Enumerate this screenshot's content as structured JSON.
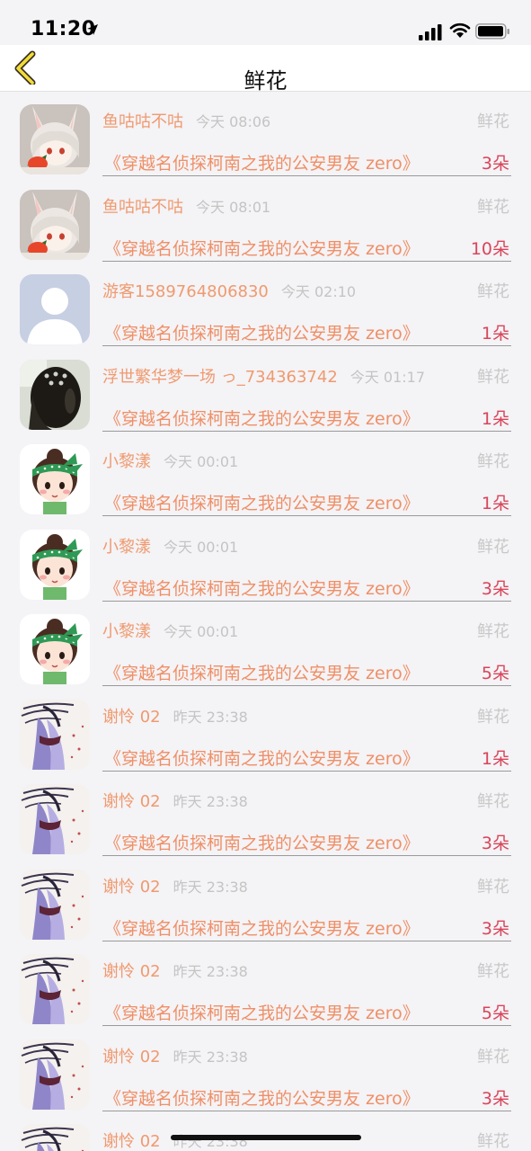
{
  "status": {
    "time": "11:20"
  },
  "nav": {
    "title": "鲜花"
  },
  "colors": {
    "name": "#ef9a6f",
    "book": "#ef8f66",
    "count": "#d8455a",
    "back": "#f2dc3a"
  },
  "items": [
    {
      "avatar": "bunny-girl",
      "name": "鱼咕咕不咕",
      "time": "今天 08:06",
      "kind": "鲜花",
      "book": "《穿越名侦探柯南之我的公安男友 zero》",
      "count": "3朵"
    },
    {
      "avatar": "bunny-girl",
      "name": "鱼咕咕不咕",
      "time": "今天 08:01",
      "kind": "鲜花",
      "book": "《穿越名侦探柯南之我的公安男友 zero》",
      "count": "10朵"
    },
    {
      "avatar": "default-user",
      "name": "游客1589764806830",
      "time": "今天 02:10",
      "kind": "鲜花",
      "book": "《穿越名侦探柯南之我的公安男友 zero》",
      "count": "1朵"
    },
    {
      "avatar": "dark-hair",
      "name": "浮世繁华梦一场 っ_734363742",
      "time": "今天 01:17",
      "kind": "鲜花",
      "book": "《穿越名侦探柯南之我的公安男友 zero》",
      "count": "1朵"
    },
    {
      "avatar": "headband-girl",
      "name": "小黎漾",
      "time": "今天 00:01",
      "kind": "鲜花",
      "book": "《穿越名侦探柯南之我的公安男友 zero》",
      "count": "1朵"
    },
    {
      "avatar": "headband-girl",
      "name": "小黎漾",
      "time": "今天 00:01",
      "kind": "鲜花",
      "book": "《穿越名侦探柯南之我的公安男友 zero》",
      "count": "3朵"
    },
    {
      "avatar": "headband-girl",
      "name": "小黎漾",
      "time": "今天 00:01",
      "kind": "鲜花",
      "book": "《穿越名侦探柯南之我的公安男友 zero》",
      "count": "5朵"
    },
    {
      "avatar": "ink-figure",
      "name": "谢怜 02",
      "time": "昨天 23:38",
      "kind": "鲜花",
      "book": "《穿越名侦探柯南之我的公安男友 zero》",
      "count": "1朵"
    },
    {
      "avatar": "ink-figure",
      "name": "谢怜 02",
      "time": "昨天 23:38",
      "kind": "鲜花",
      "book": "《穿越名侦探柯南之我的公安男友 zero》",
      "count": "3朵"
    },
    {
      "avatar": "ink-figure",
      "name": "谢怜 02",
      "time": "昨天 23:38",
      "kind": "鲜花",
      "book": "《穿越名侦探柯南之我的公安男友 zero》",
      "count": "3朵"
    },
    {
      "avatar": "ink-figure",
      "name": "谢怜 02",
      "time": "昨天 23:38",
      "kind": "鲜花",
      "book": "《穿越名侦探柯南之我的公安男友 zero》",
      "count": "5朵"
    },
    {
      "avatar": "ink-figure",
      "name": "谢怜 02",
      "time": "昨天 23:38",
      "kind": "鲜花",
      "book": "《穿越名侦探柯南之我的公安男友 zero》",
      "count": "3朵"
    },
    {
      "avatar": "ink-figure",
      "name": "谢怜 02",
      "time": "昨天 23:38",
      "kind": "鲜花",
      "book": "",
      "count": ""
    }
  ]
}
